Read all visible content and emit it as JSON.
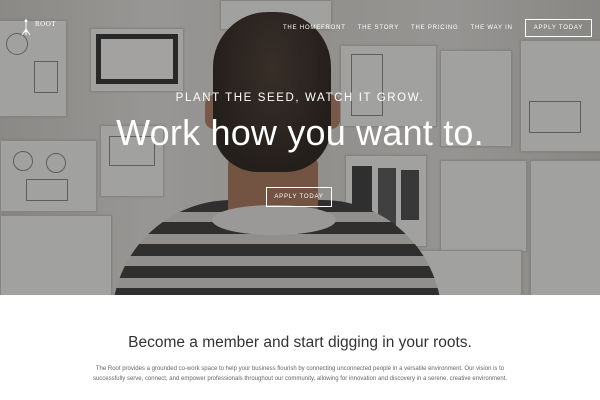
{
  "brand": {
    "name": "ROOT",
    "logo_icon": "root-tree-icon"
  },
  "nav": {
    "items": [
      "THE HOMEFRONT",
      "THE STORY",
      "THE PRICING",
      "THE WAY IN"
    ],
    "cta": "APPLY TODAY"
  },
  "hero": {
    "tagline": "PLANT THE SEED, WATCH IT GROW.",
    "headline": "Work how you want to.",
    "cta": "APPLY TODAY"
  },
  "intro": {
    "title": "Become a member and start digging in your roots.",
    "description": "The Root provides a grounded co-work space to help your business flourish by connecting unconnected people in a versatile environment. Our vision is to successfully serve, connect, and empower professionals throughout our community, allowing for innovation and discovery in a serene, creative environment."
  },
  "colors": {
    "text_dark": "#333333",
    "text_muted": "#666666",
    "overlay": "#1e1e20"
  }
}
